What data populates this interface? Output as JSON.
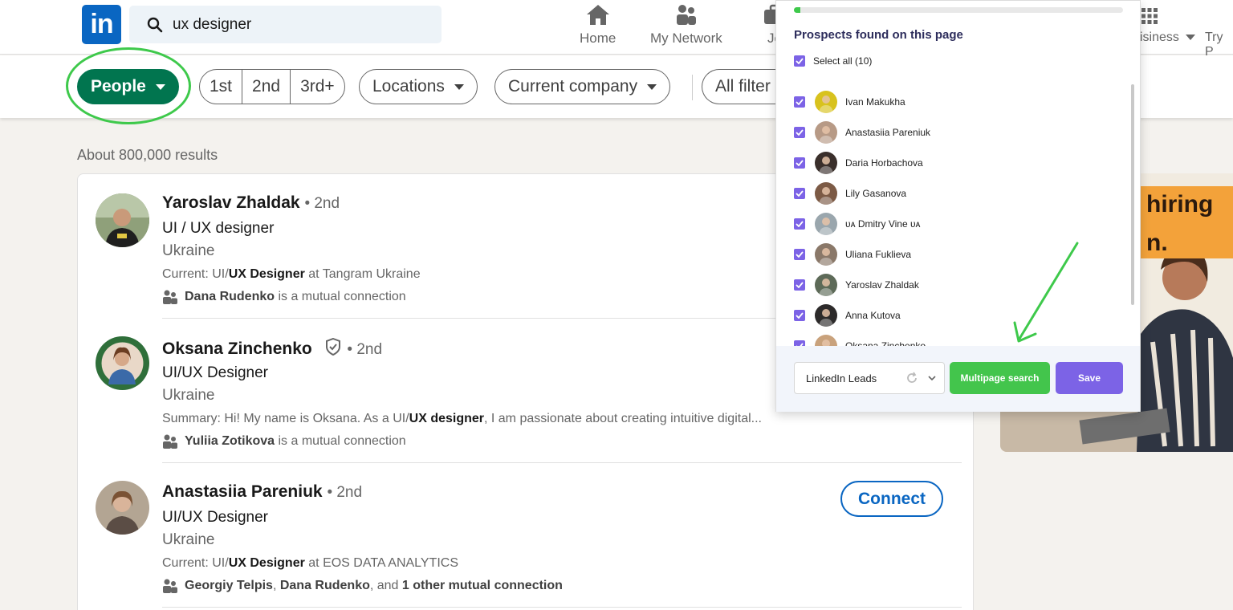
{
  "nav": {
    "logo_text": "in",
    "search_value": "ux designer",
    "items": [
      {
        "label": "Home"
      },
      {
        "label": "My Network"
      },
      {
        "label": "Jo"
      }
    ],
    "business_label": "isiness",
    "try_label": "Try P"
  },
  "filters": {
    "people": "People",
    "degrees": [
      "1st",
      "2nd",
      "3rd+"
    ],
    "locations": "Locations",
    "current_company": "Current company",
    "all_filters": "All filter"
  },
  "results_count": "About 800,000 results",
  "results": [
    {
      "name": "Yaroslav Zhaldak",
      "degree": "• 2nd",
      "headline": "UI / UX designer",
      "location": "Ukraine",
      "summary_prefix": "Current: UI/",
      "summary_bold": "UX Designer",
      "summary_suffix": " at Tangram Ukraine",
      "mutual_bold": "Dana Rudenko",
      "mutual_text": " is a mutual connection"
    },
    {
      "name": "Oksana Zinchenko",
      "degree": "• 2nd",
      "headline": "UI/UX Designer",
      "location": "Ukraine",
      "summary_prefix": "Summary: Hi! My name is Oksana. As a UI/",
      "summary_bold": "UX designer",
      "summary_suffix": ", I am passionate about creating intuitive digital...",
      "mutual_bold": "Yuliia Zotikova",
      "mutual_text": " is a mutual connection"
    },
    {
      "name": "Anastasiia Pareniuk",
      "degree": "• 2nd",
      "headline": "UI/UX Designer",
      "location": "Ukraine",
      "summary_prefix": "Current: UI/",
      "summary_bold": "UX Designer",
      "summary_suffix": " at EOS DATA ANALYTICS",
      "mutual_bold": "Georgiy Telpis",
      "mutual_sep": ", ",
      "mutual_bold2": "Dana Rudenko",
      "mutual_text": ", and ",
      "mutual_bold3": "1 other mutual connection",
      "connect_label": "Connect"
    }
  ],
  "ad": {
    "line1": "hiring",
    "line2": "n."
  },
  "extension": {
    "progress": 0.02,
    "title": "Prospects found on this page",
    "select_all": "Select all (10)",
    "prospects": [
      {
        "name": "Ivan Makukha",
        "avatar_color": "#d8c21e"
      },
      {
        "name": "Anastasiia Pareniuk",
        "avatar_color": "#b79a86"
      },
      {
        "name": "Daria Horbachova",
        "avatar_color": "#3a2f2b"
      },
      {
        "name": "Lily Gasanova",
        "avatar_color": "#7c5a45"
      },
      {
        "name": "ᴜᴀ Dmitry Vine ᴜᴀ",
        "avatar_color": "#9aa6ad"
      },
      {
        "name": "Uliana Fuklieva",
        "avatar_color": "#8a7869"
      },
      {
        "name": "Yaroslav Zhaldak",
        "avatar_color": "#5d6a58"
      },
      {
        "name": "Anna Kutova",
        "avatar_color": "#2c2a2a"
      },
      {
        "name": "Oksana Zinchenko",
        "avatar_color": "#c9a27c"
      }
    ],
    "source": "LinkedIn Leads",
    "multipage_label": "Multipage search",
    "save_label": "Save"
  }
}
